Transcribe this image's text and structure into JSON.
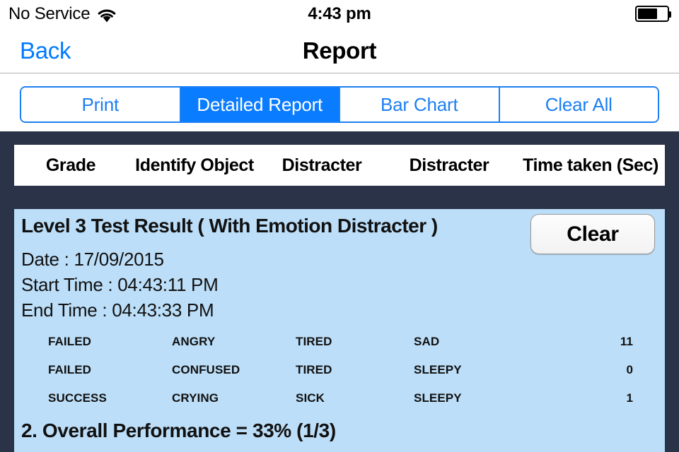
{
  "status_bar": {
    "carrier": "No Service",
    "wifi_icon": "wifi-icon",
    "time": "4:43 pm",
    "battery_icon": "battery-icon",
    "battery_level_percent": 62
  },
  "nav_bar": {
    "back_label": "Back",
    "title": "Report"
  },
  "segmented_control": {
    "selected_index": 1,
    "segments": [
      {
        "label": "Print"
      },
      {
        "label": "Detailed Report"
      },
      {
        "label": "Bar Chart"
      },
      {
        "label": "Clear All"
      }
    ]
  },
  "table": {
    "headers": [
      "Grade",
      "Identify Object",
      "Distracter",
      "Distracter",
      "Time taken (Sec)"
    ]
  },
  "result_card": {
    "title": "Level 3 Test Result ( With Emotion Distracter )",
    "clear_label": "Clear",
    "date_line": "Date : 17/09/2015",
    "start_time_line": "Start Time : 04:43:11 PM",
    "end_time_line": "End Time : 04:43:33 PM",
    "rows": [
      {
        "grade": "FAILED",
        "identify_object": "ANGRY",
        "distracter_1": "TIRED",
        "distracter_2": "SAD",
        "time_taken": "11"
      },
      {
        "grade": "FAILED",
        "identify_object": "CONFUSED",
        "distracter_1": "TIRED",
        "distracter_2": "SLEEPY",
        "time_taken": "0"
      },
      {
        "grade": "SUCCESS",
        "identify_object": "CRYING",
        "distracter_1": "SICK",
        "distracter_2": "SLEEPY",
        "time_taken": "1"
      }
    ],
    "overall_performance": "2. Overall Performance = 33% (1/3)"
  },
  "colors": {
    "accent_blue": "#007aff",
    "segment_blue": "#0a7cff",
    "segment_border": "#1c7ff2",
    "dark_navy": "#2b3349",
    "card_light_blue": "#bcdef8",
    "white": "#ffffff",
    "text_black": "#111111"
  }
}
